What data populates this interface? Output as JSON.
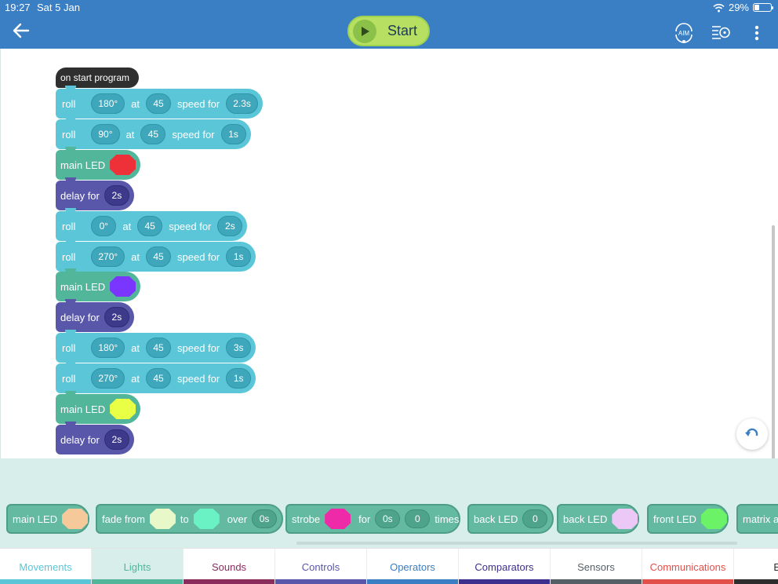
{
  "status": {
    "time": "19:27",
    "date": "Sat 5 Jan",
    "battery": "29%",
    "battery_level": 0.29
  },
  "header": {
    "start_label": "Start",
    "icons": [
      "back-arrow-icon",
      "play-icon",
      "aim-icon",
      "drive-speed-icon",
      "more-vertical-icon"
    ],
    "aim_text": "AIM"
  },
  "program": {
    "hat_label": "on start program",
    "blocks": [
      {
        "type": "roll",
        "heading": "180°",
        "at": "at",
        "speed": "45",
        "speed_for": "speed for",
        "duration": "2.3s"
      },
      {
        "type": "roll",
        "heading": "90°",
        "at": "at",
        "speed": "45",
        "speed_for": "speed for",
        "duration": "1s"
      },
      {
        "type": "main_led",
        "label": "main LED",
        "color": "#ee3038"
      },
      {
        "type": "delay",
        "label": "delay for",
        "duration": "2s"
      },
      {
        "type": "roll",
        "heading": "0°",
        "at": "at",
        "speed": "45",
        "speed_for": "speed for",
        "duration": "2s"
      },
      {
        "type": "roll",
        "heading": "270°",
        "at": "at",
        "speed": "45",
        "speed_for": "speed for",
        "duration": "1s"
      },
      {
        "type": "main_led",
        "label": "main LED",
        "color": "#7a35ff"
      },
      {
        "type": "delay",
        "label": "delay for",
        "duration": "2s"
      },
      {
        "type": "roll",
        "heading": "180°",
        "at": "at",
        "speed": "45",
        "speed_for": "speed for",
        "duration": "3s"
      },
      {
        "type": "roll",
        "heading": "270°",
        "at": "at",
        "speed": "45",
        "speed_for": "speed for",
        "duration": "1s"
      },
      {
        "type": "main_led",
        "label": "main LED",
        "color": "#e9ff45"
      },
      {
        "type": "delay",
        "label": "delay for",
        "duration": "2s"
      }
    ],
    "roll_label": "roll"
  },
  "palette": {
    "main_led": {
      "label": "main LED",
      "color": "#f6c99a"
    },
    "fade": {
      "from_label": "fade from",
      "from_color": "#e9f8c9",
      "to_label": "to",
      "to_color": "#6bf2c4",
      "over_label": "over",
      "duration": "0s"
    },
    "strobe": {
      "label": "strobe",
      "color": "#ee2aa8",
      "for_label": "for",
      "duration": "0s",
      "count": "0",
      "times_label": "times"
    },
    "back_led_value": {
      "label": "back LED",
      "value": "0"
    },
    "back_led_color": {
      "label": "back LED",
      "color": "#ecc8f6"
    },
    "front_led": {
      "label": "front LED",
      "color": "#6cf267"
    },
    "matrix": {
      "label": "matrix an"
    }
  },
  "tabs": [
    {
      "label": "Movements",
      "color": "#5bc6d8",
      "active": false
    },
    {
      "label": "Lights",
      "color": "#51b69a",
      "active": true
    },
    {
      "label": "Sounds",
      "color": "#8a2d5d",
      "active": false
    },
    {
      "label": "Controls",
      "color": "#5957a9",
      "active": false
    },
    {
      "label": "Operators",
      "color": "#3a7fc3",
      "active": false
    },
    {
      "label": "Comparators",
      "color": "#3d2f8d",
      "active": false
    },
    {
      "label": "Sensors",
      "color": "#556066",
      "active": false
    },
    {
      "label": "Communications",
      "color": "#e2504a",
      "active": false
    },
    {
      "label": "Ev",
      "color": "#2e2e2e",
      "active": false
    }
  ]
}
